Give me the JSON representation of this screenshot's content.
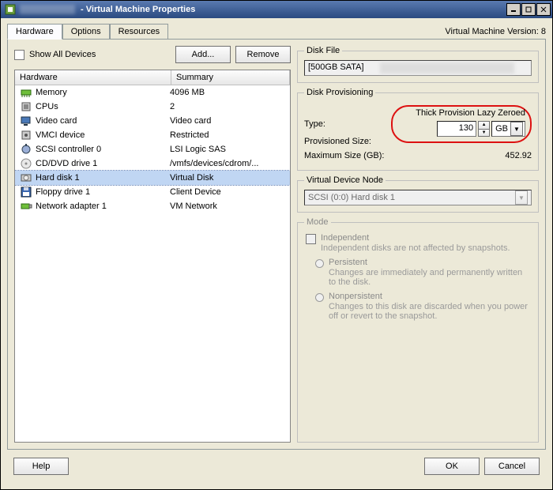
{
  "titlebar": {
    "suffix": " - Virtual Machine Properties"
  },
  "version_label": "Virtual Machine Version: 8",
  "tabs": {
    "hardware": "Hardware",
    "options": "Options",
    "resources": "Resources"
  },
  "show_all": {
    "label": "Show All Devices"
  },
  "buttons": {
    "add": "Add...",
    "remove": "Remove",
    "help": "Help",
    "ok": "OK",
    "cancel": "Cancel"
  },
  "hw_header": {
    "col1": "Hardware",
    "col2": "Summary"
  },
  "hw": [
    {
      "icon": "memory-icon",
      "name": "Memory",
      "summary": "4096 MB",
      "selected": false
    },
    {
      "icon": "cpu-icon",
      "name": "CPUs",
      "summary": "2",
      "selected": false
    },
    {
      "icon": "video-icon",
      "name": "Video card",
      "summary": "Video card",
      "selected": false
    },
    {
      "icon": "chip-icon",
      "name": "VMCI device",
      "summary": "Restricted",
      "selected": false
    },
    {
      "icon": "scsi-icon",
      "name": "SCSI controller 0",
      "summary": "LSI Logic SAS",
      "selected": false
    },
    {
      "icon": "cd-icon",
      "name": "CD/DVD drive 1",
      "summary": "/vmfs/devices/cdrom/...",
      "selected": false
    },
    {
      "icon": "hdd-icon",
      "name": "Hard disk 1",
      "summary": "Virtual Disk",
      "selected": true
    },
    {
      "icon": "floppy-icon",
      "name": "Floppy drive 1",
      "summary": "Client Device",
      "selected": false
    },
    {
      "icon": "nic-icon",
      "name": "Network adapter 1",
      "summary": "VM Network",
      "selected": false
    }
  ],
  "diskfile": {
    "legend": "Disk File",
    "value": "[500GB SATA] "
  },
  "prov": {
    "legend": "Disk Provisioning",
    "type_label": "Type:",
    "type_value": "Thick Provision Lazy Zeroed",
    "size_label": "Provisioned Size:",
    "size_value": "130",
    "unit": "GB",
    "max_label": "Maximum Size (GB):",
    "max_value": "452.92"
  },
  "vdn": {
    "legend": "Virtual Device Node",
    "value": "SCSI (0:0) Hard disk 1"
  },
  "mode": {
    "legend": "Mode",
    "independent": "Independent",
    "independent_hint": "Independent disks are not affected by snapshots.",
    "persistent": "Persistent",
    "persistent_hint": "Changes are immediately and permanently written to the disk.",
    "nonpersistent": "Nonpersistent",
    "nonpersistent_hint": "Changes to this disk are discarded when you power off or revert to the snapshot."
  }
}
